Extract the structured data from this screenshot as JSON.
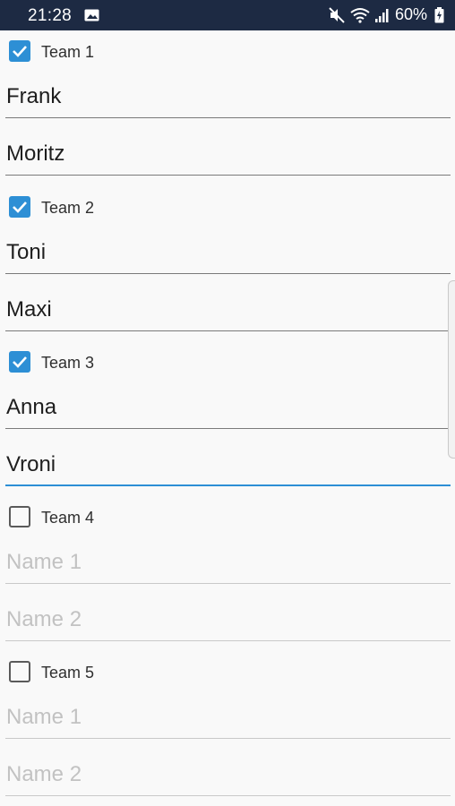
{
  "status_bar": {
    "time": "21:28",
    "battery": "60%",
    "icons": [
      "image-icon",
      "mute-icon",
      "wifi-icon",
      "signal-icon",
      "battery-charging-icon"
    ]
  },
  "colors": {
    "accent": "#2d8fd5",
    "status_bar_bg": "#1d2a43",
    "background": "#f9f9f9"
  },
  "teams": [
    {
      "label": "Team 1",
      "checked": true,
      "name1": "Frank",
      "name2": "Moritz"
    },
    {
      "label": "Team 2",
      "checked": true,
      "name1": "Toni",
      "name2": "Maxi"
    },
    {
      "label": "Team 3",
      "checked": true,
      "name1": "Anna",
      "name2": "Vroni"
    },
    {
      "label": "Team 4",
      "checked": false,
      "name1": "",
      "name2": ""
    },
    {
      "label": "Team 5",
      "checked": false,
      "name1": "",
      "name2": ""
    }
  ],
  "placeholders": {
    "name1": "Name 1",
    "name2": "Name 2"
  }
}
